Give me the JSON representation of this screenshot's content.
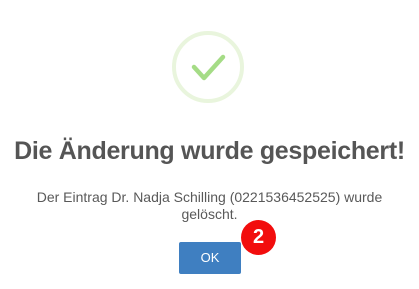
{
  "dialog": {
    "icon": "checkmark-success-icon",
    "title": "Die Änderung wurde gespeichert!",
    "message": "Der Eintrag Dr. Nadja Schilling (0221536452525) wurde gelöscht.",
    "ok_label": "OK"
  },
  "annotation": {
    "step_number": "2"
  },
  "colors": {
    "success_ring": "#e9f5dd",
    "checkmark": "#a5dc86",
    "button": "#3f7fc1",
    "badge": "#f20d0d"
  }
}
